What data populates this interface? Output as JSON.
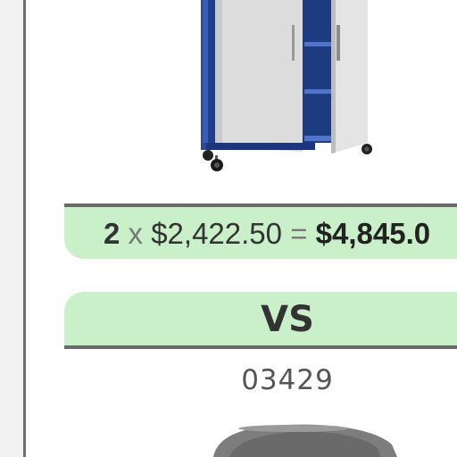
{
  "comparison": {
    "item_a": {
      "image": "storage-cabinet-image",
      "quantity": "2",
      "times": "x",
      "unit_price": "$2,422.50",
      "equals": "=",
      "total": "$4,845.0"
    },
    "separator": "VS",
    "item_b": {
      "sku": "03429",
      "image": "gray-seat-image"
    }
  },
  "colors": {
    "accent_green": "#c9f0c9",
    "rule_gray": "#6a6a6a",
    "cabinet_blue": "#1f3f8f",
    "door_gray": "#d9d9d9"
  }
}
